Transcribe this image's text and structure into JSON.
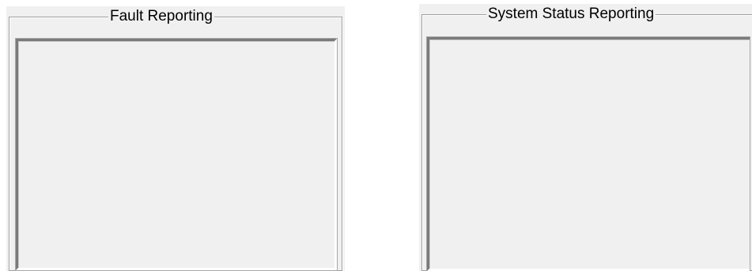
{
  "panels": {
    "fault_reporting": {
      "title": "Fault Reporting"
    },
    "system_status_reporting": {
      "title": "System Status Reporting"
    }
  },
  "colors": {
    "panel_background": "#f0f0f0",
    "frame_line": "#a0a0a0",
    "inset_shadow": "#7a7a7a"
  }
}
